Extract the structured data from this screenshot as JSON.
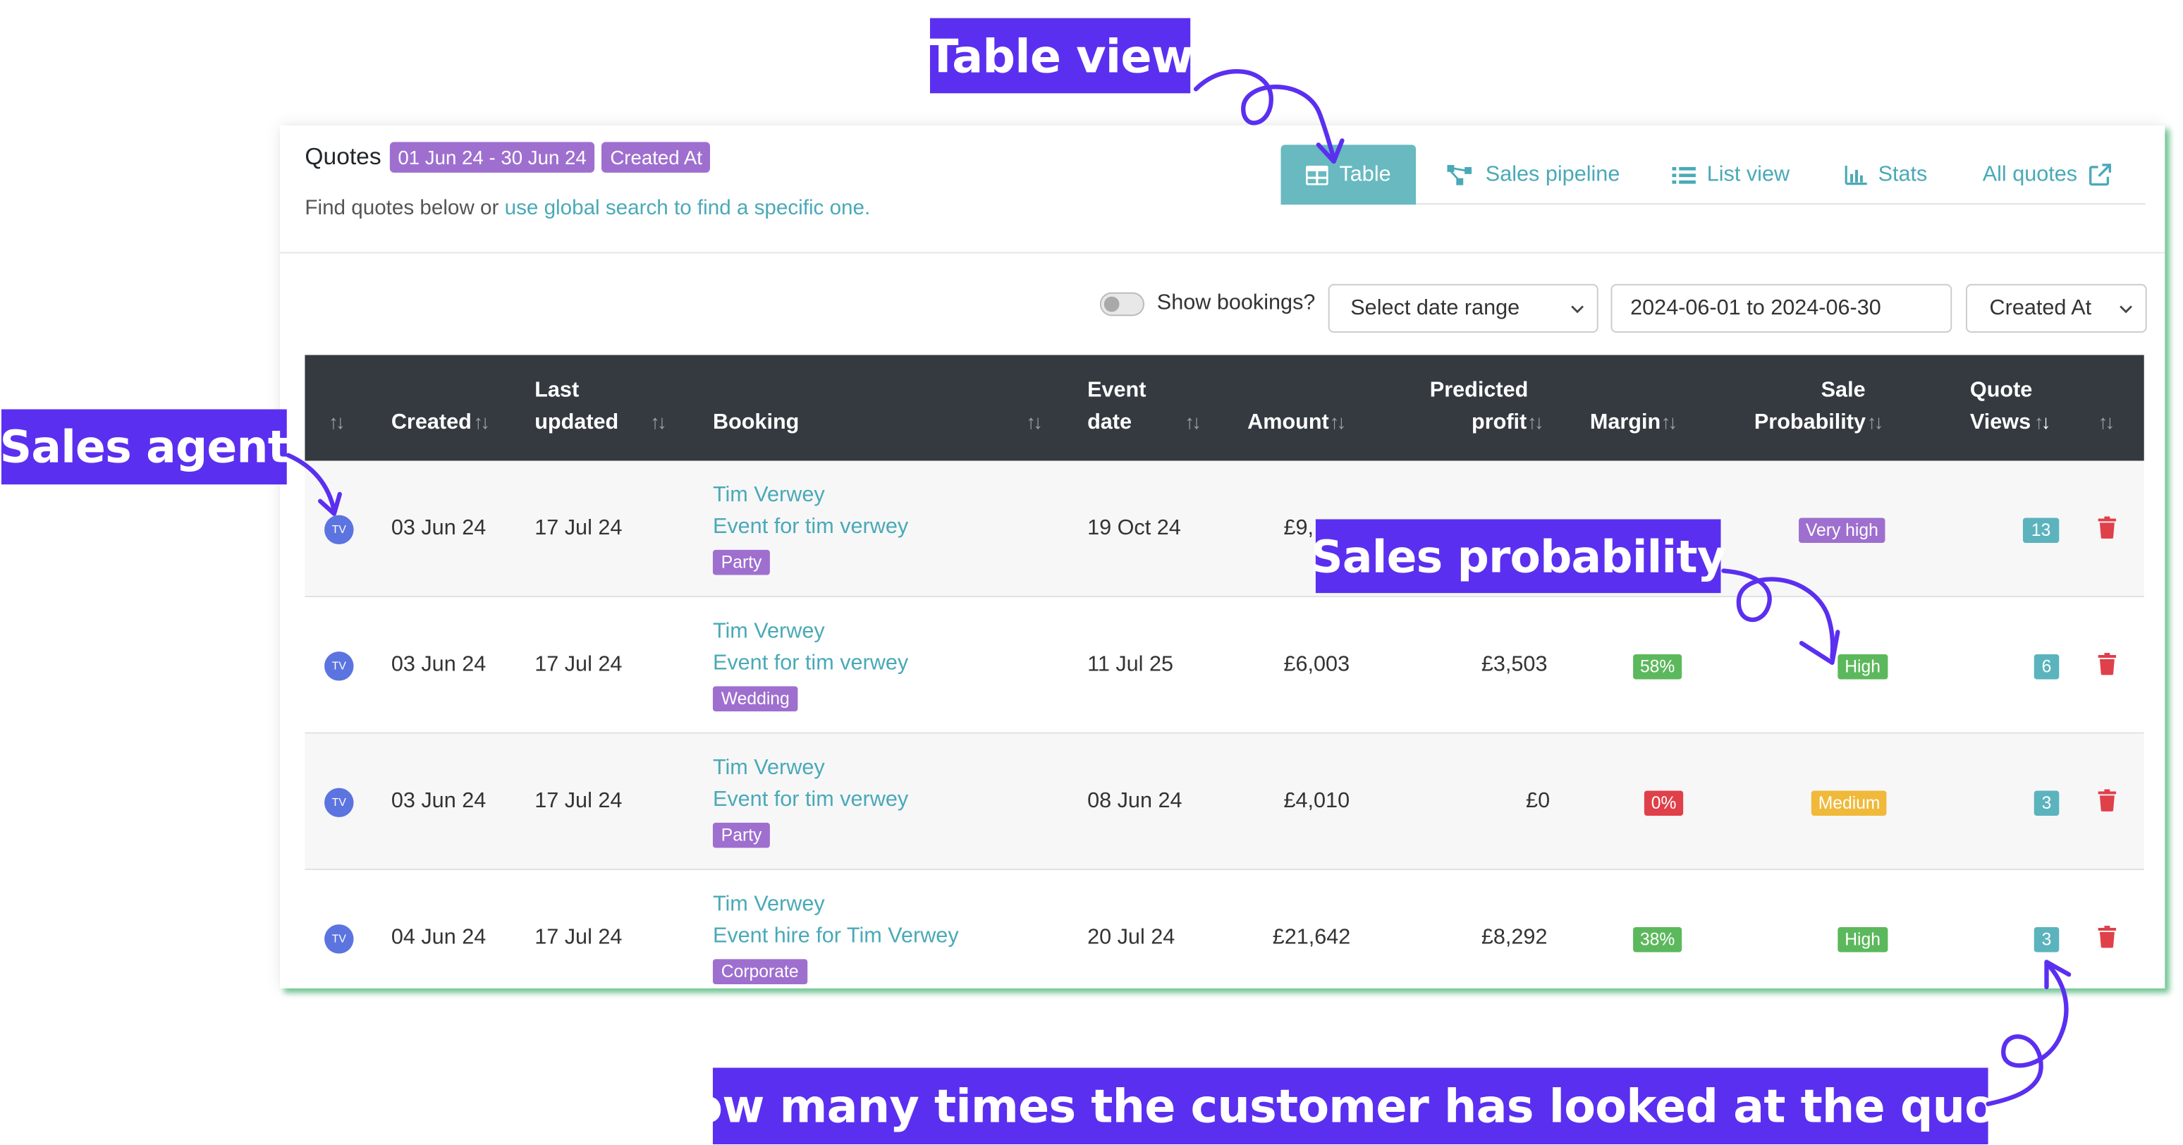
{
  "header": {
    "title": "Quotes",
    "date_badge": "01 Jun 24 - 30 Jun 24",
    "field_badge": "Created At",
    "subtitle_prefix": "Find quotes below or ",
    "subtitle_link": "use global search to find a specific one."
  },
  "view_tabs": [
    {
      "label": "Table",
      "icon": "table-icon",
      "active": true
    },
    {
      "label": "Sales pipeline",
      "icon": "pipeline-icon",
      "active": false
    },
    {
      "label": "List view",
      "icon": "list-icon",
      "active": false
    },
    {
      "label": "Stats",
      "icon": "bar-chart-icon",
      "active": false
    },
    {
      "label": "All quotes",
      "icon": "external-link-icon",
      "active": false
    }
  ],
  "filters": {
    "show_bookings_label": "Show bookings?",
    "date_range_select": "Select date range",
    "date_range_value": "2024-06-01 to 2024-06-30",
    "date_field_select": "Created At"
  },
  "table": {
    "headers": {
      "created": "Created",
      "last_updated_1": "Last",
      "last_updated_2": "updated",
      "booking": "Booking",
      "event_date_1": "Event",
      "event_date_2": "date",
      "amount": "Amount",
      "profit_1": "Predicted",
      "profit_2": "profit",
      "margin": "Margin",
      "probability_1": "Sale",
      "probability_2": "Probability",
      "views_1": "Quote",
      "views_2": "Views"
    },
    "rows": [
      {
        "agent": "TV",
        "created": "03 Jun 24",
        "updated": "17 Jul 24",
        "name": "Tim Verwey",
        "event": "Event for tim verwey",
        "tag": "Party",
        "event_date": "19 Oct 24",
        "amount": "£9,",
        "profit": "",
        "margin": "",
        "probability": "Very high",
        "views": "13"
      },
      {
        "agent": "TV",
        "created": "03 Jun 24",
        "updated": "17 Jul 24",
        "name": "Tim Verwey",
        "event": "Event for tim verwey",
        "tag": "Wedding",
        "event_date": "11 Jul 25",
        "amount": "£6,003",
        "profit": "£3,503",
        "margin": "58%",
        "probability": "High",
        "views": "6"
      },
      {
        "agent": "TV",
        "created": "03 Jun 24",
        "updated": "17 Jul 24",
        "name": "Tim Verwey",
        "event": "Event for tim verwey",
        "tag": "Party",
        "event_date": "08 Jun 24",
        "amount": "£4,010",
        "profit": "£0",
        "margin": "0%",
        "probability": "Medium",
        "views": "3"
      },
      {
        "agent": "TV",
        "created": "04 Jun 24",
        "updated": "17 Jul 24",
        "name": "Tim Verwey",
        "event": "Event hire for Tim Verwey",
        "tag": "Corporate",
        "event_date": "20 Jul 24",
        "amount": "£21,642",
        "profit": "£8,292",
        "margin": "38%",
        "probability": "High",
        "views": "3"
      }
    ]
  },
  "annotations": {
    "table_view": "Table view",
    "sales_agent": "Sales agent",
    "sales_probability": "Sales probability",
    "quote_views": "How many times the customer has looked at the quote"
  },
  "colors": {
    "accent_teal": "#68b9c0",
    "link": "#4aa9b7",
    "tag_purple": "#9e6fcf",
    "annotation": "#5b2ff0",
    "green": "#5cb85c",
    "red": "#e0404a",
    "yellow": "#f0b93a",
    "header_dark": "#343a40",
    "trash_red": "#e0404a"
  }
}
